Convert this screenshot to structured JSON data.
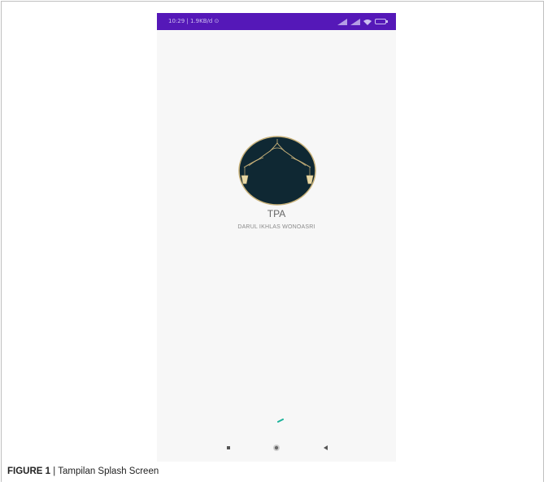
{
  "status_bar": {
    "time_info": "10:29 | 1.9KB/d ⊙",
    "background": "#5518b8",
    "icons": [
      "signal-icon",
      "signal-icon",
      "wifi-icon",
      "battery-icon"
    ]
  },
  "splash": {
    "logo_icon": "mosque-arch-lantern-logo",
    "logo_color": "#0f2833",
    "title": "TPA",
    "subtitle": "DARUL IKHLAS WONOASRI",
    "loader_color": "#1bb39a"
  },
  "nav_bar": {
    "icons": [
      "recent-apps-icon",
      "home-icon",
      "back-icon"
    ]
  },
  "caption": {
    "label": "FIGURE 1",
    "separator": " | ",
    "text": "Tampilan Splash Screen"
  }
}
